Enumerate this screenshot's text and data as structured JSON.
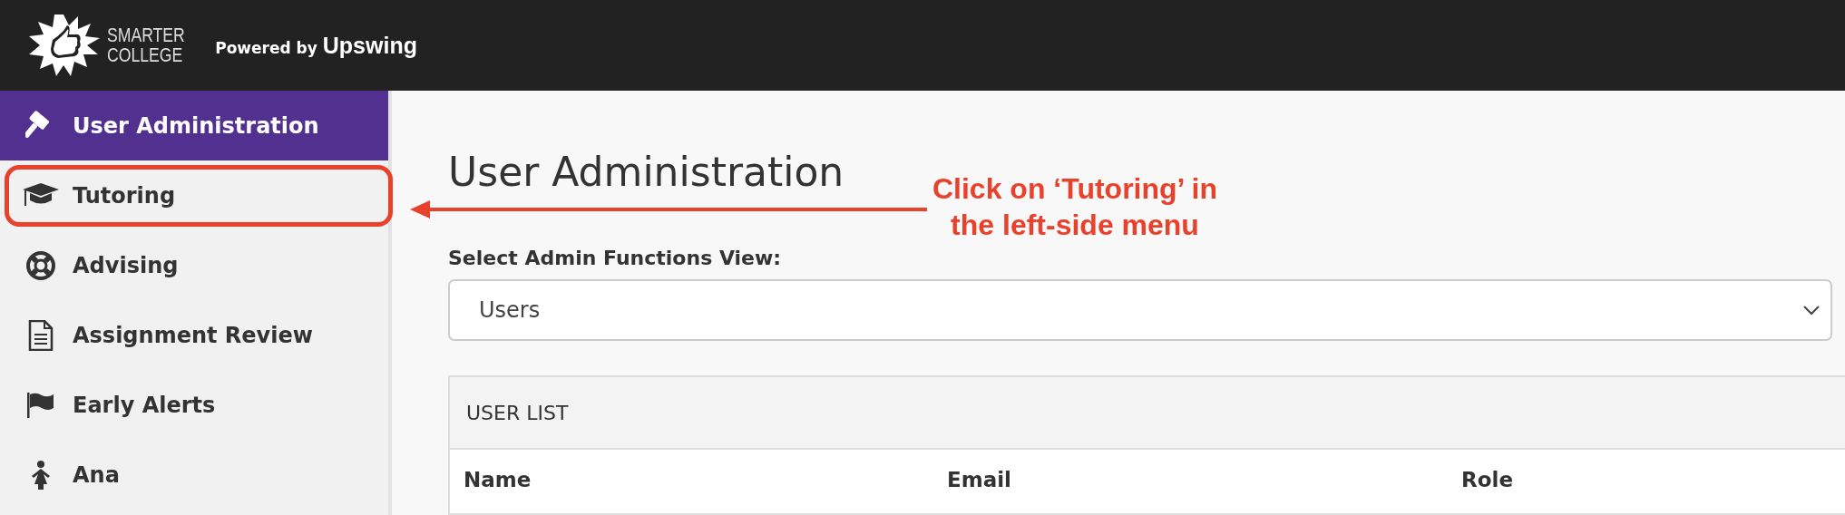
{
  "header": {
    "logo_lines": [
      "SMARTER",
      "COLLEGE"
    ],
    "powered_by": "Powered by",
    "brand": "Upswing"
  },
  "sidebar": {
    "items": [
      {
        "label": "User Administration",
        "selected": true,
        "highlighted": false
      },
      {
        "label": "Tutoring",
        "selected": false,
        "highlighted": true
      },
      {
        "label": "Advising",
        "selected": false,
        "highlighted": false
      },
      {
        "label": "Assignment Review",
        "selected": false,
        "highlighted": false
      },
      {
        "label": "Early Alerts",
        "selected": false,
        "highlighted": false
      },
      {
        "label": "Ana",
        "selected": false,
        "highlighted": false
      }
    ]
  },
  "main": {
    "title": "User Administration",
    "view_label": "Select Admin Functions View:",
    "view_select": {
      "value": "Users"
    },
    "panel": {
      "title": "USER LIST",
      "columns": [
        "Name",
        "Email",
        "Role"
      ]
    }
  },
  "annotation": {
    "text_lines": [
      "Click on ‘Tutoring’ in",
      "the left-side menu"
    ]
  }
}
